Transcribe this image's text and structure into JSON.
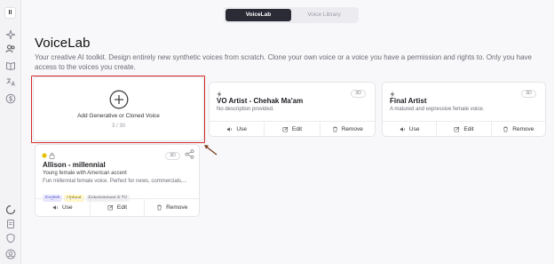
{
  "sidebar": {
    "logo_label": "II",
    "icons": [
      "sparkle-icon",
      "voices-icon",
      "book-icon",
      "translate-icon",
      "dollar-icon"
    ],
    "bottom_icons": [
      "loading-icon",
      "document-icon",
      "shield-icon",
      "user-icon"
    ]
  },
  "tabs": [
    {
      "label": "VoiceLab",
      "active": true
    },
    {
      "label": "Voice Library",
      "active": false
    }
  ],
  "page": {
    "title": "VoiceLab",
    "description": "Your creative AI toolkit. Design entirely new synthetic voices from scratch. Clone your own voice or a voice you have a permission and rights to. Only you have access to the voices you create."
  },
  "add_card": {
    "label": "Add Generative or Cloned Voice",
    "count": "3 / 30"
  },
  "voices": [
    {
      "name": "VO Artist - Chehak Ma'am",
      "badge": "3D",
      "description": "No description provided.",
      "actions": {
        "use": "Use",
        "edit": "Edit",
        "remove": "Remove"
      }
    },
    {
      "name": "Final Artist",
      "badge": "3D",
      "description": "A matured and expressive female voice.",
      "actions": {
        "use": "Use",
        "edit": "Edit",
        "remove": "Remove"
      }
    },
    {
      "name": "Allison - millennial",
      "badge": "3D",
      "subtitle": "Young female with American accent",
      "description": "Fun millennial female voice. Perfect for news, commercials,...",
      "tags": [
        "English",
        "Upbeat",
        "Entertainment & TV"
      ],
      "actions": {
        "use": "Use",
        "edit": "Edit",
        "remove": "Remove"
      }
    }
  ],
  "colors": {
    "accent_dark": "#2b2b36",
    "highlight": "#d42a2a",
    "arrow": "#7a3d1b"
  }
}
